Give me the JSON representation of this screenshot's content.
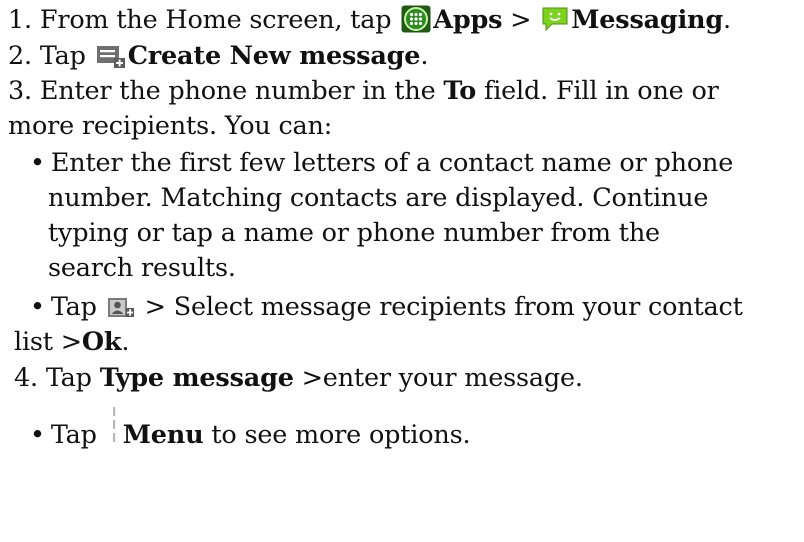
{
  "step1": {
    "prefix": "1. From the Home screen, tap ",
    "apps_label": "Apps",
    "separator": " > ",
    "messaging_label": "Messaging",
    "period": "."
  },
  "step2": {
    "prefix": "2. Tap ",
    "create_label": "Create New message",
    "period": "."
  },
  "step3": {
    "line1_prefix": "3. Enter the phone number in the ",
    "to_label": "To",
    "line1_suffix": " field. Fill in one or",
    "line2": "more recipients. You can:"
  },
  "bullet_a": {
    "line1": "Enter the first few letters of a contact name or phone",
    "line2": "number. Matching contacts are displayed. Continue",
    "line3": "typing or tap a name or phone number from the",
    "line4": "search results."
  },
  "bullet_b": {
    "prefix": "Tap ",
    "suffix": " > Select message recipients from your contact",
    "line2_prefix": "list >",
    "ok_label": "Ok",
    "period": "."
  },
  "step4": {
    "prefix": "4. Tap ",
    "type_label": "Type message",
    "suffix": " >enter your message."
  },
  "bullet_c": {
    "prefix": "Tap ",
    "menu_label": "Menu",
    "suffix": " to see more options."
  },
  "bullet_char": "•"
}
